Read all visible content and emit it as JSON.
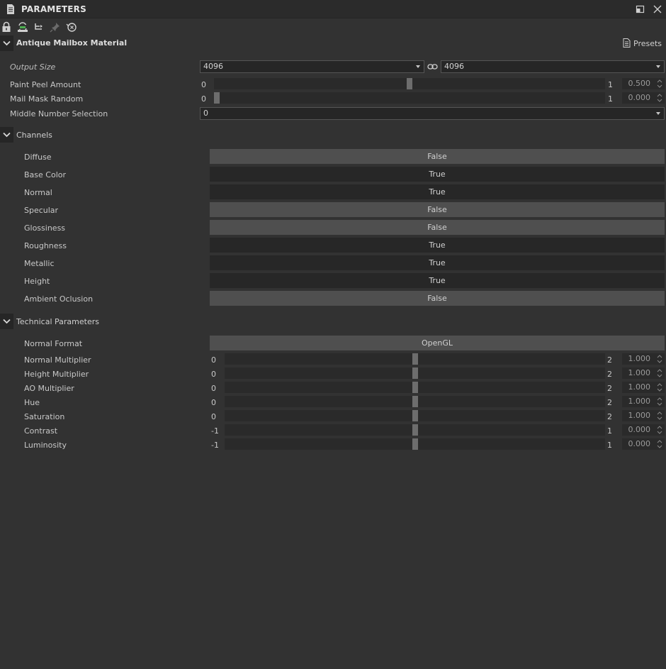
{
  "window": {
    "title": "PARAMETERS"
  },
  "toolbar": {
    "icons": [
      "lock-icon",
      "refresh-graph-icon",
      "tree-link-icon",
      "pin-icon",
      "reset-icon"
    ]
  },
  "material": {
    "title": "Antique Mailbox Material",
    "presets_label": "Presets",
    "output_size": {
      "label": "Output Size",
      "width_value": "4096",
      "height_value": "4096"
    },
    "paint_peel": {
      "label": "Paint Peel Amount",
      "min": "0",
      "max": "1",
      "value": "0.500",
      "fraction": 0.5
    },
    "mail_mask": {
      "label": "Mail Mask Random",
      "min": "0",
      "max": "1",
      "value": "0.000",
      "fraction": 0.0
    },
    "middle_number": {
      "label": "Middle Number Selection",
      "value": "0"
    }
  },
  "channels": {
    "title": "Channels",
    "items": [
      {
        "label": "Diffuse",
        "value": "False"
      },
      {
        "label": "Base Color",
        "value": "True"
      },
      {
        "label": "Normal",
        "value": "True"
      },
      {
        "label": "Specular",
        "value": "False"
      },
      {
        "label": "Glossiness",
        "value": "False"
      },
      {
        "label": "Roughness",
        "value": "True"
      },
      {
        "label": "Metallic",
        "value": "True"
      },
      {
        "label": "Height",
        "value": "True"
      },
      {
        "label": "Ambient Oclusion",
        "value": "False"
      }
    ]
  },
  "technical": {
    "title": "Technical Parameters",
    "normal_format": {
      "label": "Normal Format",
      "value": "OpenGL"
    },
    "sliders": [
      {
        "label": "Normal Multiplier",
        "min": "0",
        "max": "2",
        "value": "1.000",
        "fraction": 0.5
      },
      {
        "label": "Height Multiplier",
        "min": "0",
        "max": "2",
        "value": "1.000",
        "fraction": 0.5
      },
      {
        "label": "AO Multiplier",
        "min": "0",
        "max": "2",
        "value": "1.000",
        "fraction": 0.5
      },
      {
        "label": "Hue",
        "min": "0",
        "max": "2",
        "value": "1.000",
        "fraction": 0.5
      },
      {
        "label": "Saturation",
        "min": "0",
        "max": "2",
        "value": "1.000",
        "fraction": 0.5
      },
      {
        "label": "Contrast",
        "min": "-1",
        "max": "1",
        "value": "0.000",
        "fraction": 0.5
      },
      {
        "label": "Luminosity",
        "min": "-1",
        "max": "1",
        "value": "0.000",
        "fraction": 0.5
      }
    ]
  }
}
